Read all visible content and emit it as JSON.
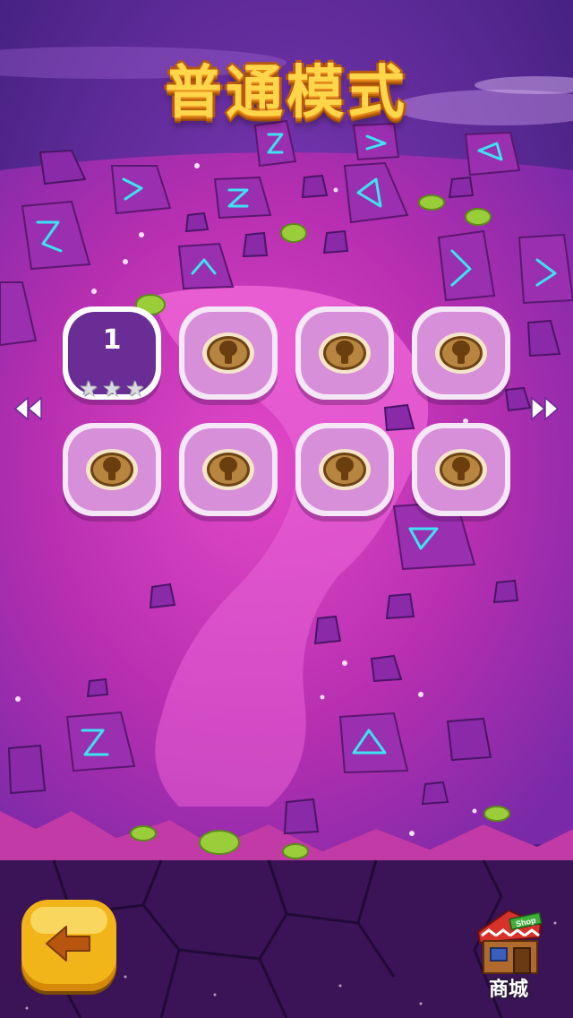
{
  "header": {
    "title": "普通模式"
  },
  "levels": [
    {
      "number": "1",
      "state": "unlocked",
      "stars_earned": 0,
      "stars_total": 3
    },
    {
      "state": "locked"
    },
    {
      "state": "locked"
    },
    {
      "state": "locked"
    },
    {
      "state": "locked"
    },
    {
      "state": "locked"
    },
    {
      "state": "locked"
    },
    {
      "state": "locked"
    }
  ],
  "icons": {
    "prev_page": "double-chevron-left-icon",
    "next_page": "double-chevron-right-icon",
    "back": "back-arrow-icon",
    "shop": "shop-house-icon",
    "lock": "keyhole-lock-icon",
    "star": "star-icon"
  },
  "shop": {
    "sign_text": "Shop",
    "label": "商城"
  },
  "colors": {
    "title_fill": "#ffd54a",
    "title_outline": "#b95a0c",
    "level_unlocked": "#6a2c95",
    "level_locked": "#d88fd9",
    "back_button": "#f2b519",
    "back_arrow": "#b8560f",
    "background_purple": "#8a2aa8",
    "background_pink": "#d63fb8"
  }
}
